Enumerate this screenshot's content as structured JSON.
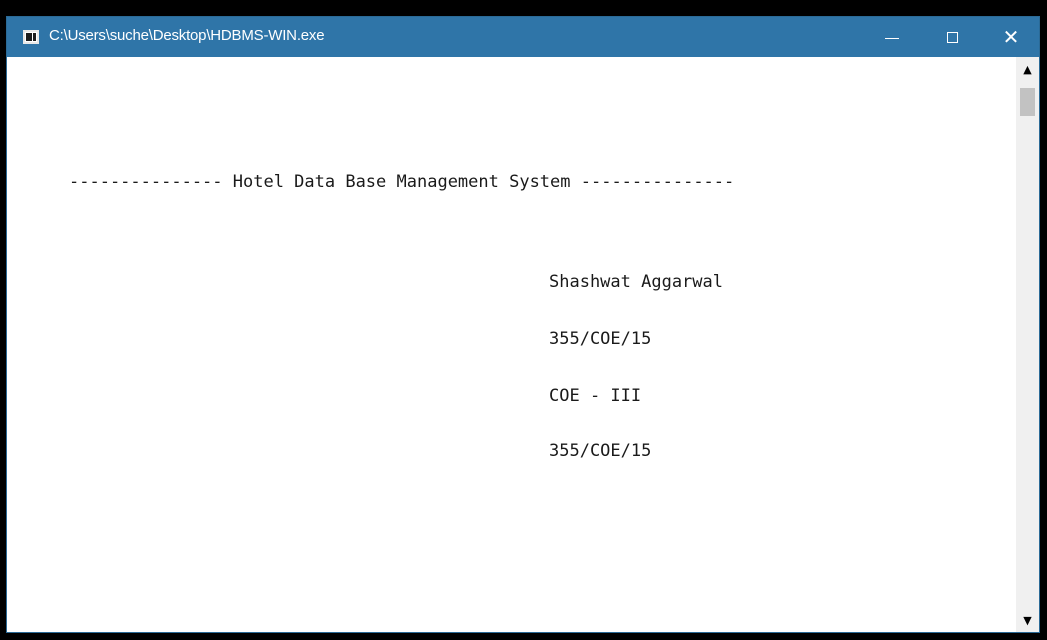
{
  "window": {
    "title": "C:\\Users\\suche\\Desktop\\HDBMS-WIN.exe",
    "minimize_glyph": "—",
    "maximize_glyph": "☐",
    "close_glyph": "✕"
  },
  "console": {
    "banner": "--------------- Hotel Data Base Management System ---------------",
    "name": "Shashwat Aggarwal",
    "roll_number": "355/COE/15",
    "class": "COE - III",
    "roll_number_repeat": "355/COE/15"
  },
  "scrollbar": {
    "up_glyph": "▲",
    "down_glyph": "▼"
  },
  "icons": {
    "app": "console-app-icon",
    "minimize": "minimize-icon",
    "maximize": "maximize-icon",
    "close": "close-icon"
  },
  "colors": {
    "titlebar": "#2f75a8",
    "console_bg": "#ffffff",
    "text": "#1a1a1a"
  }
}
